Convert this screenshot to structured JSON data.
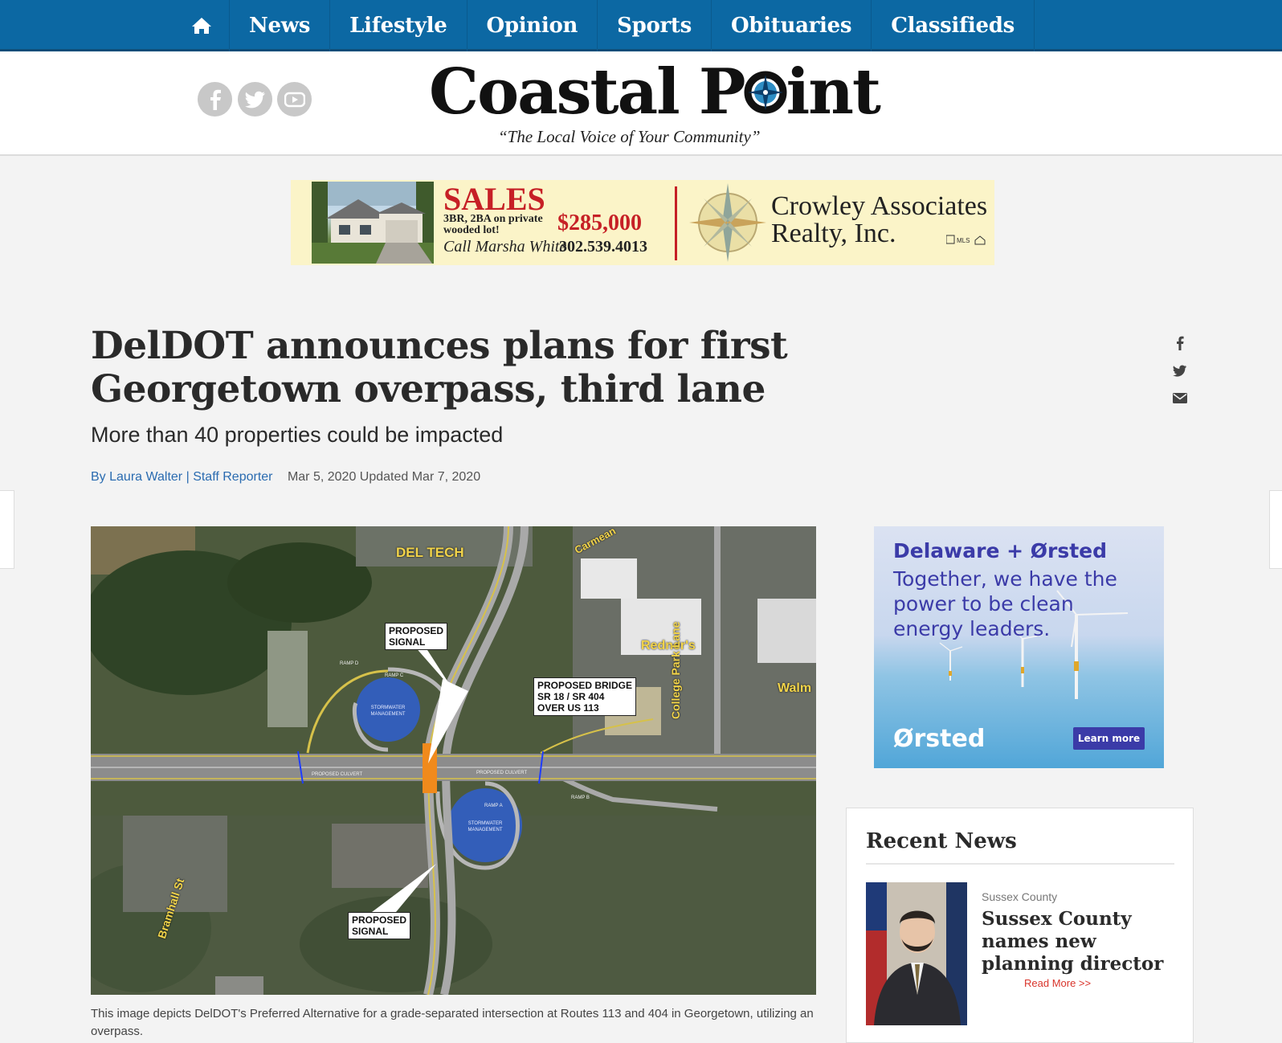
{
  "nav": {
    "home_icon": "home-icon",
    "items": [
      "News",
      "Lifestyle",
      "Opinion",
      "Sports",
      "Obituaries",
      "Classifieds"
    ]
  },
  "masthead": {
    "social_icons": [
      "facebook-icon",
      "twitter-icon",
      "youtube-icon"
    ],
    "logo_part1": "Coastal P",
    "logo_part2": "int",
    "tagline": "“The Local Voice of Your Community”"
  },
  "banner_ad": {
    "headline": "SALES",
    "details": "3BR, 2BA on private wooded lot!",
    "price": "$285,000",
    "call": "Call Marsha White",
    "phone": "302.539.4013",
    "company_line1": "Crowley Associates",
    "company_line2": "Realty, Inc."
  },
  "article": {
    "headline": "DelDOT announces plans for first Georgetown overpass, third lane",
    "subhead": "More than 40 properties could be impacted",
    "author": "By Laura Walter",
    "separator": "|",
    "role": "Staff Reporter",
    "date": "Mar 5, 2020 Updated Mar 7, 2020",
    "share_icons": [
      "facebook-icon",
      "twitter-icon",
      "envelope-icon"
    ],
    "caption": "This image depicts DelDOT's Preferred Alternative for a grade-separated intersection at Routes 113 and 404 in Georgetown, utilizing an overpass."
  },
  "map": {
    "del_tech": "DEL TECH",
    "carmean": "Carmean",
    "redners": "Redner's",
    "college_park": "College Park Lane",
    "walmart": "Walm",
    "bramhall": "Bramhall St",
    "signal_top_1": "PROPOSED",
    "signal_top_2": "SIGNAL",
    "bridge_1": "PROPOSED BRIDGE",
    "bridge_2": "SR 18 / SR 404",
    "bridge_3": "OVER US 113",
    "signal_bottom_1": "PROPOSED",
    "signal_bottom_2": "SIGNAL",
    "stormwater_1": "STORMWATER MANAGEMENT",
    "stormwater_2": "STORMWATER MANAGEMENT",
    "culvert_1": "PROPOSED CULVERT",
    "culvert_2": "PROPOSED CULVERT",
    "ramp_a": "RAMP A",
    "ramp_b": "RAMP B",
    "ramp_c": "RAMP C",
    "ramp_d": "RAMP D"
  },
  "sidebar_ad": {
    "title": "Delaware + Ørsted",
    "body": "Together, we have the power to be clean energy leaders.",
    "logo": "Ørsted",
    "button": "Learn more"
  },
  "recent_news": {
    "title": "Recent News",
    "category": "Sussex County",
    "headline": "Sussex County names new planning director",
    "read_more": "Read More >>"
  },
  "colors": {
    "nav_blue": "#0c68a3",
    "link_blue": "#2a6bb0",
    "ad_red": "#c62026",
    "orsted_purple": "#3b3ba8",
    "read_more_red": "#d9342b"
  }
}
